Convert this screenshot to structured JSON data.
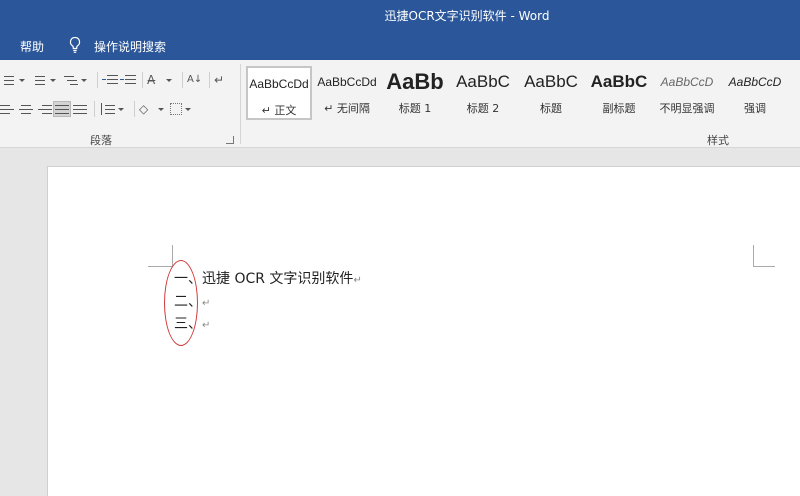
{
  "titlebar": {
    "title": "迅捷OCR文字识别软件  -  Word"
  },
  "menubar": {
    "help": "帮助",
    "tell_me": "操作说明搜索"
  },
  "ribbon": {
    "paragraph_group": "段落",
    "styles_group": "样式",
    "styles": [
      {
        "sample": "AaBbCcDd",
        "name": "↵ 正文"
      },
      {
        "sample": "AaBbCcDd",
        "name": "↵ 无间隔"
      },
      {
        "sample": "AaBb",
        "name": "标题 1"
      },
      {
        "sample": "AaBbC",
        "name": "标题 2"
      },
      {
        "sample": "AaBbC",
        "name": "标题"
      },
      {
        "sample": "AaBbC",
        "name": "副标题"
      },
      {
        "sample": "AaBbCcD",
        "name": "不明显强调"
      },
      {
        "sample": "AaBbCcD",
        "name": "强调"
      }
    ]
  },
  "document": {
    "lines": [
      {
        "text": "一、迅捷 OCR 文字识别软件",
        "mark": "↵"
      },
      {
        "text": "二、",
        "mark": "↵"
      },
      {
        "text": "三、",
        "mark": "↵"
      }
    ]
  },
  "colors": {
    "brand": "#2b579a",
    "annotation": "#d23b3b"
  }
}
